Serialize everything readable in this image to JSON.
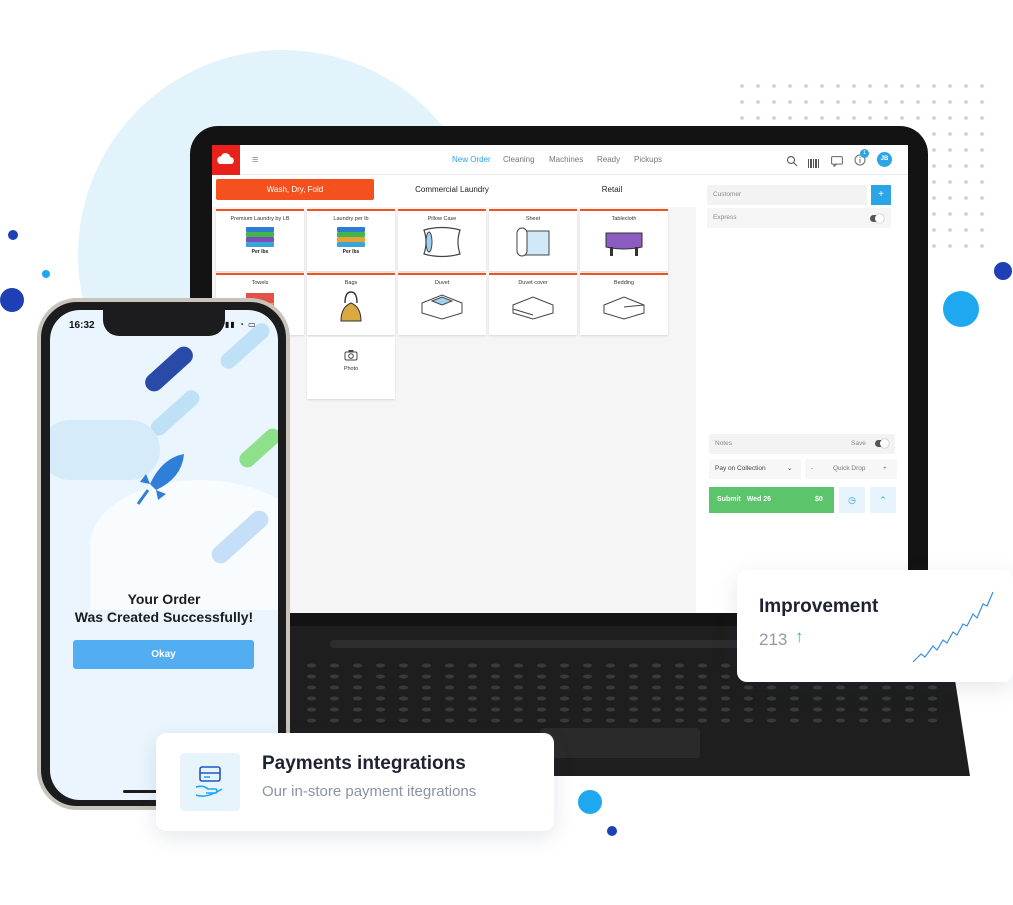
{
  "app": {
    "nav": [
      "New Order",
      "Cleaning",
      "Machines",
      "Ready",
      "Pickups"
    ],
    "menu_glyph": "≡",
    "avatar": "JB",
    "notification_count": "1",
    "categories": [
      "Wash, Dry, Fold",
      "Commercial Laundry",
      "Retail"
    ],
    "tiles": [
      {
        "label": "Premium Laundry by LB",
        "sub": "Per lbs",
        "icon": "laundry-stack-icon"
      },
      {
        "label": "Laundry per lb",
        "sub": "Per lbs",
        "icon": "laundry-stack-icon"
      },
      {
        "label": "Pillow Case",
        "sub": "",
        "icon": "pillow-icon"
      },
      {
        "label": "Sheet",
        "sub": "",
        "icon": "sheet-icon"
      },
      {
        "label": "Tablecloth",
        "sub": "",
        "icon": "tablecloth-icon"
      },
      {
        "label": "Towels",
        "sub": "",
        "icon": "towels-icon"
      },
      {
        "label": "Bags",
        "sub": "",
        "icon": "bag-icon"
      },
      {
        "label": "Duvet",
        "sub": "",
        "icon": "duvet-icon"
      },
      {
        "label": "Duvet cover",
        "sub": "",
        "icon": "duvet-cover-icon"
      },
      {
        "label": "Bedding",
        "sub": "",
        "icon": "bedding-icon"
      },
      {
        "label": "Photo",
        "sub": "",
        "icon": "camera-icon"
      }
    ],
    "side": {
      "customer_placeholder": "Customer",
      "add_glyph": "+",
      "express_label": "Express",
      "notes_placeholder": "Notes",
      "save_label": "Save",
      "payment_select": "Pay on Collection",
      "minus_glyph": "-",
      "quick_drop_label": "Quick Drop",
      "plus_glyph": "+",
      "submit_label": "Submit",
      "submit_date": "Wed 26",
      "submit_total": "$0"
    }
  },
  "phone": {
    "time": "16:32",
    "title_line1": "Your Order",
    "title_line2": "Was Created Successfully!",
    "okay_label": "Okay"
  },
  "improvement_card": {
    "title": "Improvement",
    "value": "213",
    "arrow": "↑"
  },
  "payments_card": {
    "title": "Payments integrations",
    "subtitle": "Our in-store payment itegrations"
  },
  "colors": {
    "brand_red": "#e8221b",
    "tab_orange": "#f4511e",
    "accent_blue": "#2ba5e6",
    "submit_green": "#5cc46a",
    "trend_green": "#2fc07a"
  }
}
